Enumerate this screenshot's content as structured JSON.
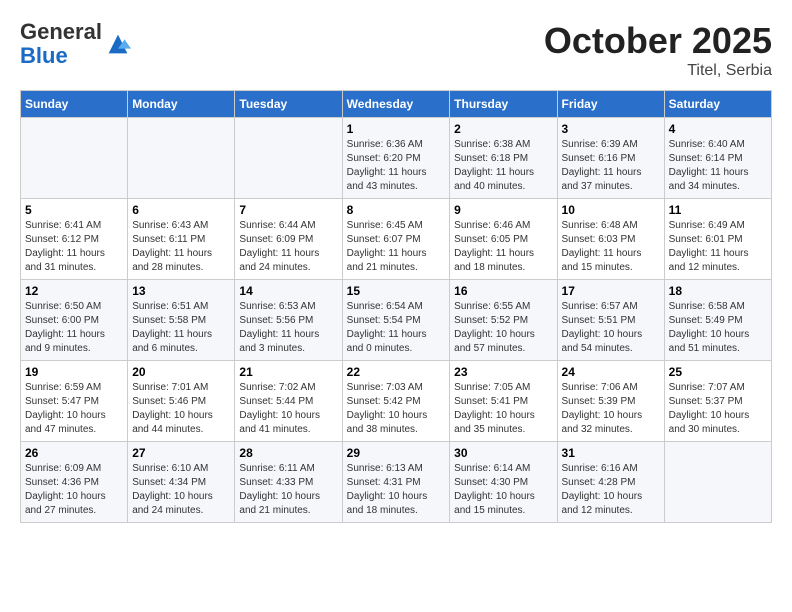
{
  "header": {
    "logo_line1": "General",
    "logo_line2": "Blue",
    "month_year": "October 2025",
    "location": "Titel, Serbia"
  },
  "days_of_week": [
    "Sunday",
    "Monday",
    "Tuesday",
    "Wednesday",
    "Thursday",
    "Friday",
    "Saturday"
  ],
  "weeks": [
    [
      {
        "day": "",
        "info": ""
      },
      {
        "day": "",
        "info": ""
      },
      {
        "day": "",
        "info": ""
      },
      {
        "day": "1",
        "info": "Sunrise: 6:36 AM\nSunset: 6:20 PM\nDaylight: 11 hours and 43 minutes."
      },
      {
        "day": "2",
        "info": "Sunrise: 6:38 AM\nSunset: 6:18 PM\nDaylight: 11 hours and 40 minutes."
      },
      {
        "day": "3",
        "info": "Sunrise: 6:39 AM\nSunset: 6:16 PM\nDaylight: 11 hours and 37 minutes."
      },
      {
        "day": "4",
        "info": "Sunrise: 6:40 AM\nSunset: 6:14 PM\nDaylight: 11 hours and 34 minutes."
      }
    ],
    [
      {
        "day": "5",
        "info": "Sunrise: 6:41 AM\nSunset: 6:12 PM\nDaylight: 11 hours and 31 minutes."
      },
      {
        "day": "6",
        "info": "Sunrise: 6:43 AM\nSunset: 6:11 PM\nDaylight: 11 hours and 28 minutes."
      },
      {
        "day": "7",
        "info": "Sunrise: 6:44 AM\nSunset: 6:09 PM\nDaylight: 11 hours and 24 minutes."
      },
      {
        "day": "8",
        "info": "Sunrise: 6:45 AM\nSunset: 6:07 PM\nDaylight: 11 hours and 21 minutes."
      },
      {
        "day": "9",
        "info": "Sunrise: 6:46 AM\nSunset: 6:05 PM\nDaylight: 11 hours and 18 minutes."
      },
      {
        "day": "10",
        "info": "Sunrise: 6:48 AM\nSunset: 6:03 PM\nDaylight: 11 hours and 15 minutes."
      },
      {
        "day": "11",
        "info": "Sunrise: 6:49 AM\nSunset: 6:01 PM\nDaylight: 11 hours and 12 minutes."
      }
    ],
    [
      {
        "day": "12",
        "info": "Sunrise: 6:50 AM\nSunset: 6:00 PM\nDaylight: 11 hours and 9 minutes."
      },
      {
        "day": "13",
        "info": "Sunrise: 6:51 AM\nSunset: 5:58 PM\nDaylight: 11 hours and 6 minutes."
      },
      {
        "day": "14",
        "info": "Sunrise: 6:53 AM\nSunset: 5:56 PM\nDaylight: 11 hours and 3 minutes."
      },
      {
        "day": "15",
        "info": "Sunrise: 6:54 AM\nSunset: 5:54 PM\nDaylight: 11 hours and 0 minutes."
      },
      {
        "day": "16",
        "info": "Sunrise: 6:55 AM\nSunset: 5:52 PM\nDaylight: 10 hours and 57 minutes."
      },
      {
        "day": "17",
        "info": "Sunrise: 6:57 AM\nSunset: 5:51 PM\nDaylight: 10 hours and 54 minutes."
      },
      {
        "day": "18",
        "info": "Sunrise: 6:58 AM\nSunset: 5:49 PM\nDaylight: 10 hours and 51 minutes."
      }
    ],
    [
      {
        "day": "19",
        "info": "Sunrise: 6:59 AM\nSunset: 5:47 PM\nDaylight: 10 hours and 47 minutes."
      },
      {
        "day": "20",
        "info": "Sunrise: 7:01 AM\nSunset: 5:46 PM\nDaylight: 10 hours and 44 minutes."
      },
      {
        "day": "21",
        "info": "Sunrise: 7:02 AM\nSunset: 5:44 PM\nDaylight: 10 hours and 41 minutes."
      },
      {
        "day": "22",
        "info": "Sunrise: 7:03 AM\nSunset: 5:42 PM\nDaylight: 10 hours and 38 minutes."
      },
      {
        "day": "23",
        "info": "Sunrise: 7:05 AM\nSunset: 5:41 PM\nDaylight: 10 hours and 35 minutes."
      },
      {
        "day": "24",
        "info": "Sunrise: 7:06 AM\nSunset: 5:39 PM\nDaylight: 10 hours and 32 minutes."
      },
      {
        "day": "25",
        "info": "Sunrise: 7:07 AM\nSunset: 5:37 PM\nDaylight: 10 hours and 30 minutes."
      }
    ],
    [
      {
        "day": "26",
        "info": "Sunrise: 6:09 AM\nSunset: 4:36 PM\nDaylight: 10 hours and 27 minutes."
      },
      {
        "day": "27",
        "info": "Sunrise: 6:10 AM\nSunset: 4:34 PM\nDaylight: 10 hours and 24 minutes."
      },
      {
        "day": "28",
        "info": "Sunrise: 6:11 AM\nSunset: 4:33 PM\nDaylight: 10 hours and 21 minutes."
      },
      {
        "day": "29",
        "info": "Sunrise: 6:13 AM\nSunset: 4:31 PM\nDaylight: 10 hours and 18 minutes."
      },
      {
        "day": "30",
        "info": "Sunrise: 6:14 AM\nSunset: 4:30 PM\nDaylight: 10 hours and 15 minutes."
      },
      {
        "day": "31",
        "info": "Sunrise: 6:16 AM\nSunset: 4:28 PM\nDaylight: 10 hours and 12 minutes."
      },
      {
        "day": "",
        "info": ""
      }
    ]
  ]
}
